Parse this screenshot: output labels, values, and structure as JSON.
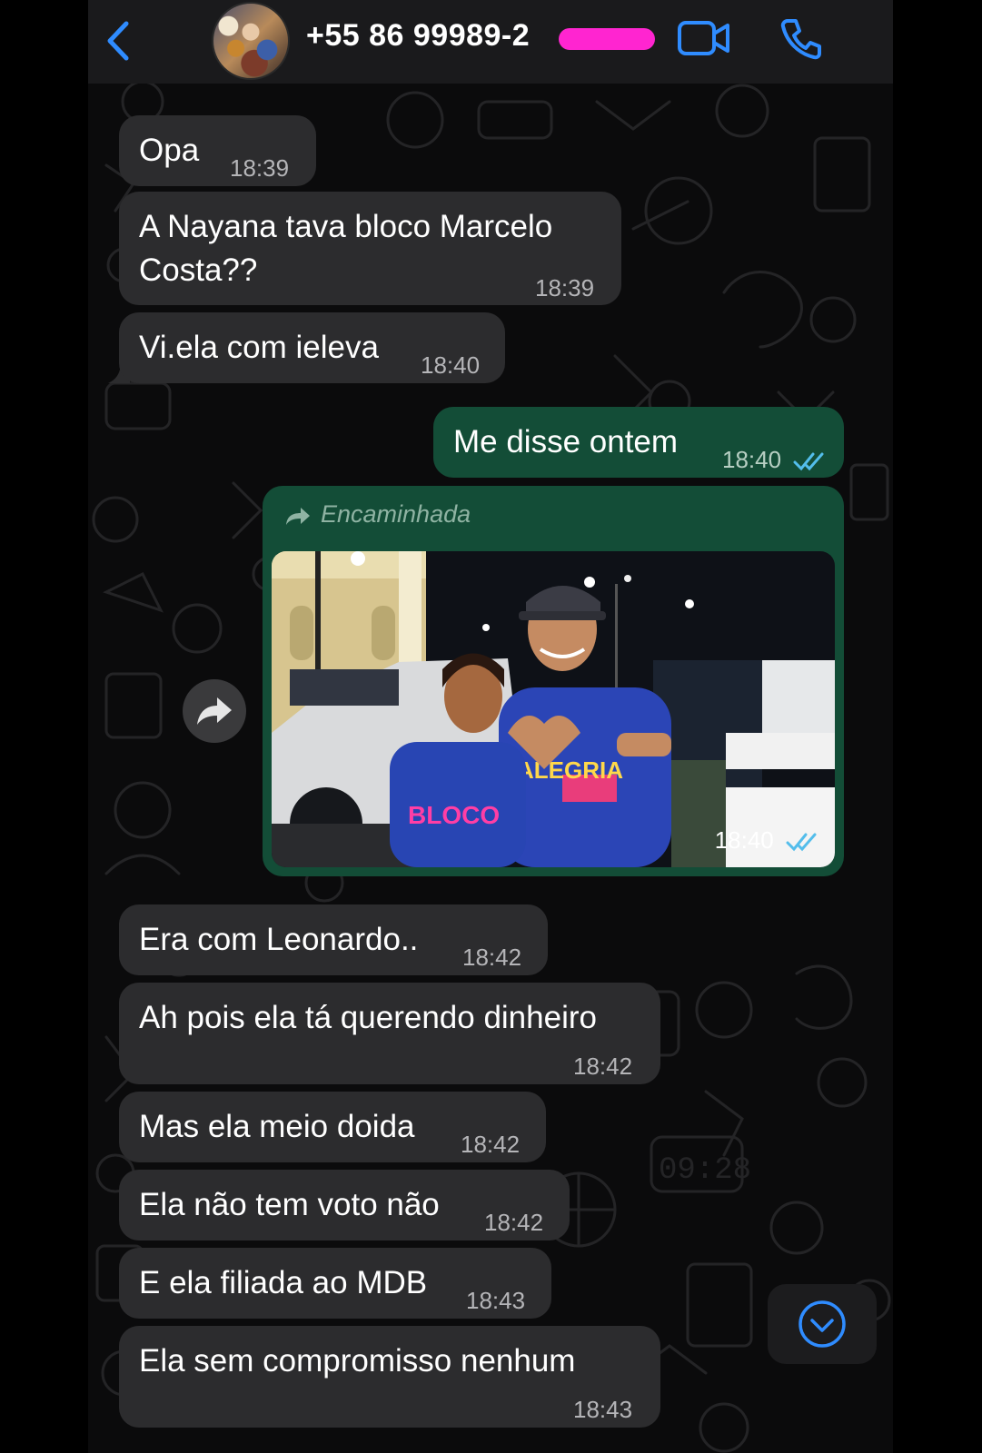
{
  "header": {
    "contact": "+55 86 99989-2",
    "icons": {
      "back": "chevron-left-icon",
      "video": "video-camera-icon",
      "call": "phone-icon"
    },
    "accent": "#2f8cff"
  },
  "messages": [
    {
      "dir": "in",
      "text": "Opa",
      "time": "18:39"
    },
    {
      "dir": "in",
      "lines": [
        "A Nayana tava bloco Marcelo",
        "Costa??"
      ],
      "time": "18:39"
    },
    {
      "dir": "in",
      "text": "Vi.ela com ieleva",
      "time": "18:40"
    },
    {
      "dir": "out",
      "text": "Me disse ontem",
      "time": "18:40"
    },
    {
      "dir": "in",
      "text": "Era com Leonardo..",
      "time": "18:42"
    },
    {
      "dir": "in",
      "text": "Ah pois ela tá querendo dinheiro",
      "time": "18:42"
    },
    {
      "dir": "in",
      "text": "Mas ela meio doida",
      "time": "18:42"
    },
    {
      "dir": "in",
      "text": "Ela não tem voto não",
      "time": "18:42"
    },
    {
      "dir": "in",
      "text": "E ela filiada ao MDB",
      "time": "18:43"
    },
    {
      "dir": "in",
      "text": "Ela sem compromisso nenhum",
      "time": "18:43"
    }
  ],
  "image_message": {
    "forward_label": "Encaminhada",
    "time": "18:40",
    "shirt_text": "ALEGRIA",
    "shirt_text2": "BLOCO"
  },
  "colors": {
    "incoming_bubble": "#2c2c2e",
    "outgoing_bubble": "#134d37",
    "read_ticks": "#53bdeb",
    "redaction": "#ff25d0"
  }
}
